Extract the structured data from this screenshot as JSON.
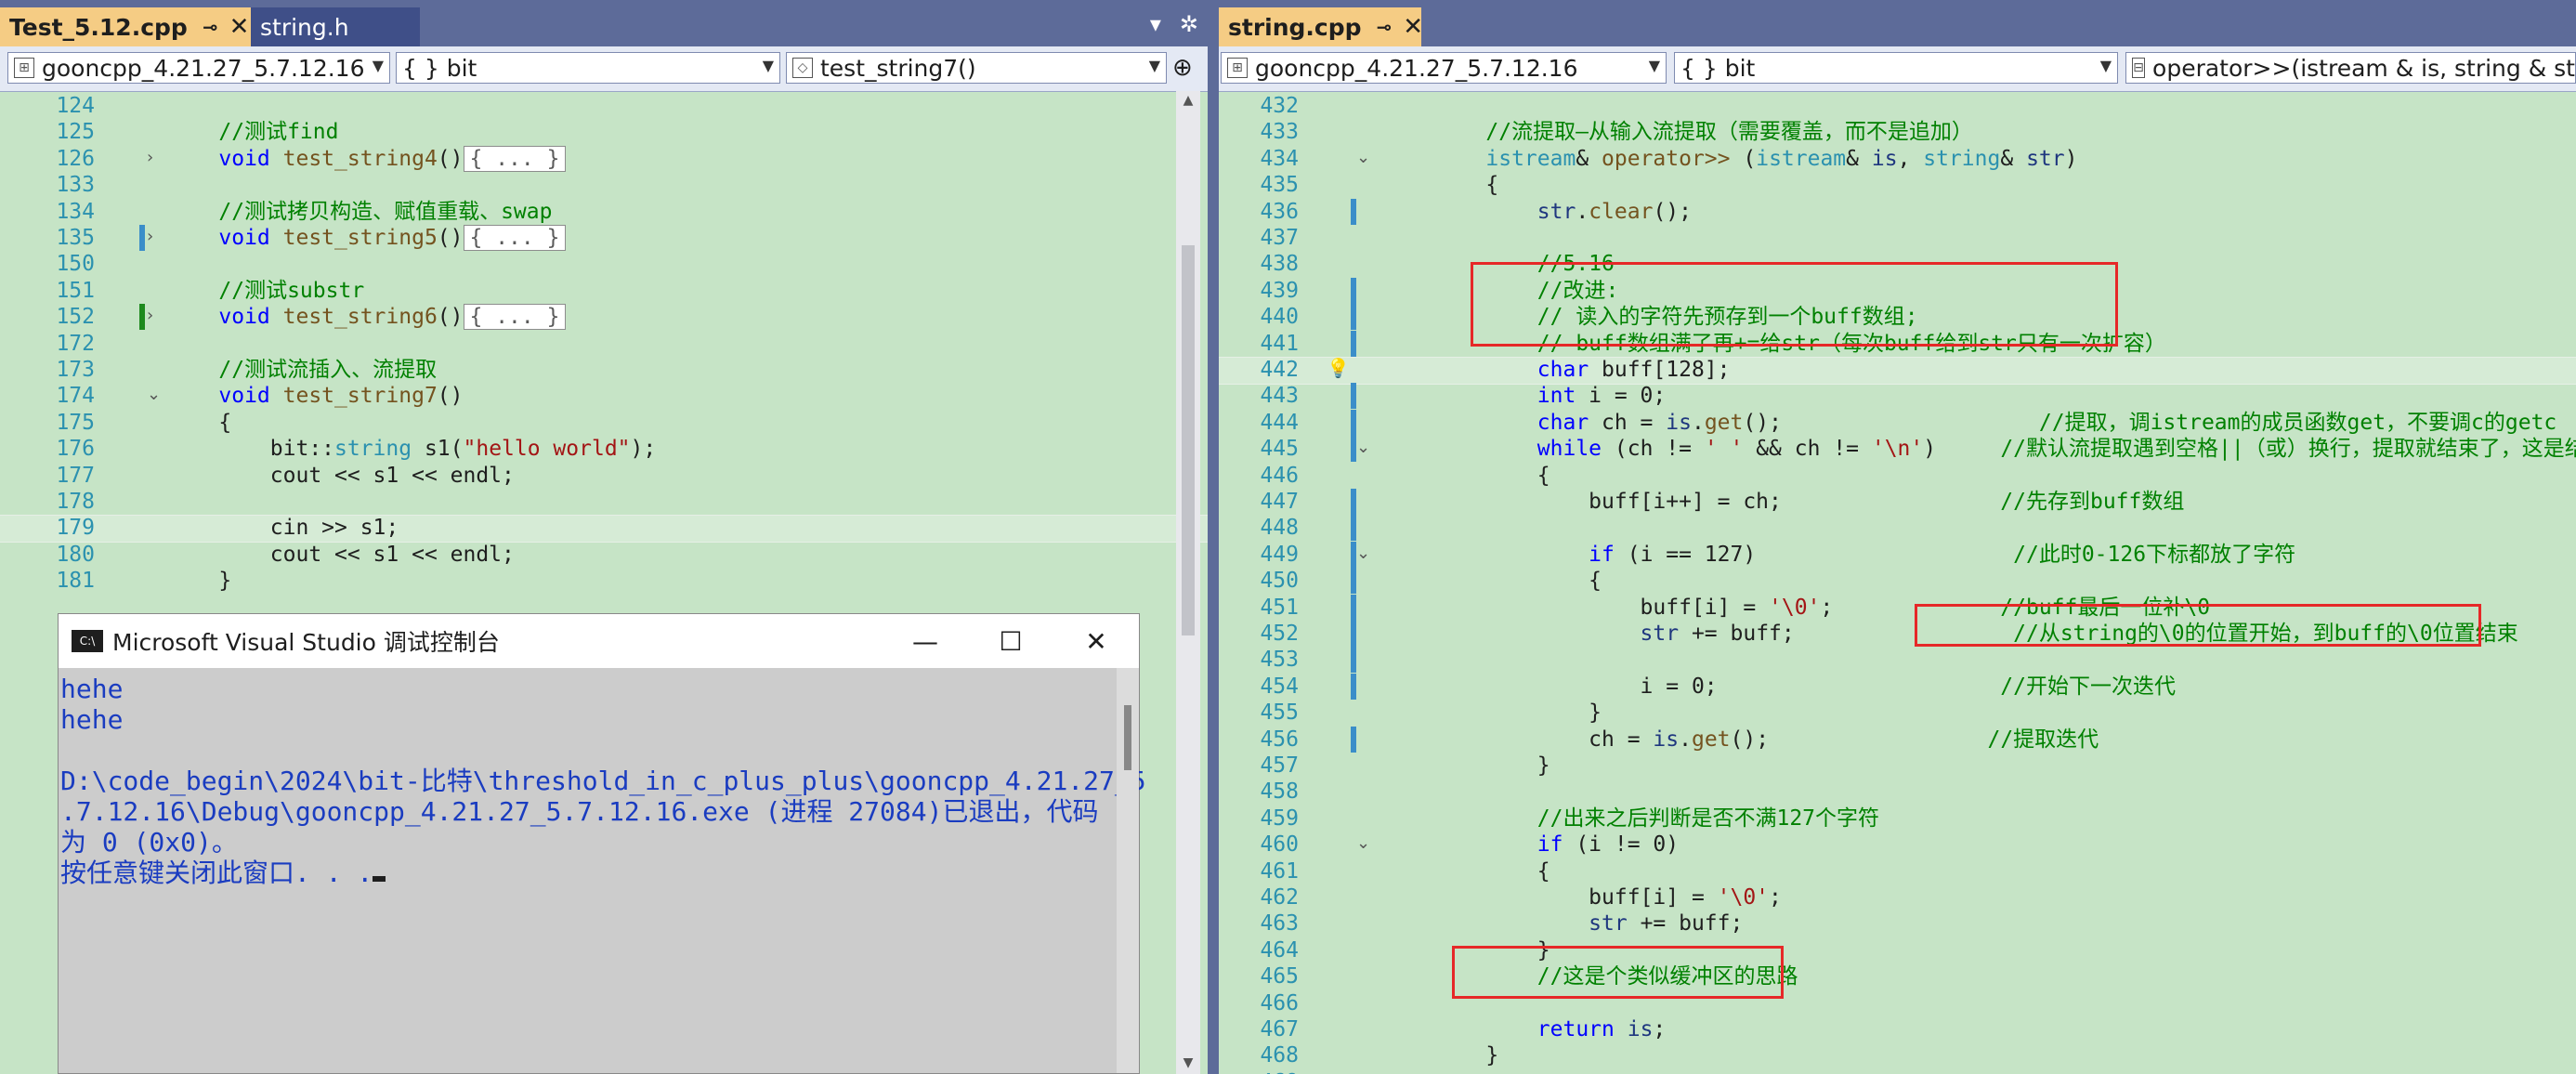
{
  "left_pane": {
    "tabs": [
      {
        "label": "Test_5.12.cpp",
        "pin": "⊸",
        "close": "✕"
      },
      {
        "label": "string.h"
      }
    ],
    "nav": {
      "project": "gooncpp_4.21.27_5.7.12.16",
      "scope": "{ } bit",
      "member": "test_string7()"
    },
    "lines": [
      {
        "n": "124",
        "segs": []
      },
      {
        "n": "125",
        "segs": [
          {
            "c": "cm",
            "t": "    //测试find"
          }
        ]
      },
      {
        "n": "126",
        "segs": [
          {
            "c": "kw",
            "t": "    void "
          },
          {
            "c": "fn",
            "t": "test_string4"
          },
          {
            "c": "",
            "t": "()"
          }
        ],
        "collapsed": "{ ... }"
      },
      {
        "n": "133",
        "segs": []
      },
      {
        "n": "134",
        "segs": [
          {
            "c": "cm",
            "t": "    //测试拷贝构造、赋值重载、swap"
          }
        ]
      },
      {
        "n": "135",
        "segs": [
          {
            "c": "kw",
            "t": "    void "
          },
          {
            "c": "fn",
            "t": "test_string5"
          },
          {
            "c": "",
            "t": "()"
          }
        ],
        "collapsed": "{ ... }"
      },
      {
        "n": "150",
        "segs": []
      },
      {
        "n": "151",
        "segs": [
          {
            "c": "cm",
            "t": "    //测试substr"
          }
        ]
      },
      {
        "n": "152",
        "segs": [
          {
            "c": "kw",
            "t": "    void "
          },
          {
            "c": "fn",
            "t": "test_string6"
          },
          {
            "c": "",
            "t": "()"
          }
        ],
        "collapsed": "{ ... }"
      },
      {
        "n": "172",
        "segs": []
      },
      {
        "n": "173",
        "segs": [
          {
            "c": "cm",
            "t": "    //测试流插入、流提取"
          }
        ]
      },
      {
        "n": "174",
        "segs": [
          {
            "c": "kw",
            "t": "    void "
          },
          {
            "c": "fn",
            "t": "test_string7"
          },
          {
            "c": "",
            "t": "()"
          }
        ]
      },
      {
        "n": "175",
        "segs": [
          {
            "c": "",
            "t": "    {"
          }
        ]
      },
      {
        "n": "176",
        "segs": [
          {
            "c": "",
            "t": "        bit::"
          },
          {
            "c": "ty",
            "t": "string"
          },
          {
            "c": "",
            "t": " s1("
          },
          {
            "c": "st",
            "t": "\"hello world\""
          },
          {
            "c": "",
            "t": ");"
          }
        ]
      },
      {
        "n": "177",
        "segs": [
          {
            "c": "",
            "t": "        cout << s1 << endl;"
          }
        ]
      },
      {
        "n": "178",
        "segs": []
      },
      {
        "n": "179",
        "segs": [
          {
            "c": "",
            "t": "        cin >> s1;"
          }
        ]
      },
      {
        "n": "180",
        "segs": [
          {
            "c": "",
            "t": "        cout << s1 << endl;"
          }
        ]
      },
      {
        "n": "181",
        "segs": [
          {
            "c": "",
            "t": "    }"
          }
        ]
      }
    ]
  },
  "console": {
    "title": "Microsoft Visual Studio 调试控制台",
    "lines": [
      "hehe",
      "hehe",
      "",
      "D:\\code_begin\\2024\\bit-比特\\threshold_in_c_plus_plus\\gooncpp_4.21.27_5",
      ".7.12.16\\Debug\\gooncpp_4.21.27_5.7.12.16.exe (进程 27084)已退出，代码",
      "为 0 (0x0)。",
      "按任意键关闭此窗口. . ."
    ]
  },
  "right_pane": {
    "tab": {
      "label": "string.cpp",
      "pin": "⊸",
      "close": "✕"
    },
    "nav": {
      "project": "gooncpp_4.21.27_5.7.12.16",
      "scope": "{ } bit",
      "member": "operator>>(istream & is, string & st"
    },
    "lines": [
      {
        "n": "432",
        "segs": []
      },
      {
        "n": "433",
        "segs": [
          {
            "c": "cm",
            "t": "    //流提取—从输入流提取（需要覆盖，而不是追加）"
          }
        ]
      },
      {
        "n": "434",
        "segs": [
          {
            "c": "ty",
            "t": "    istream"
          },
          {
            "c": "",
            "t": "& "
          },
          {
            "c": "fn",
            "t": "operator>>"
          },
          {
            "c": "",
            "t": " ("
          },
          {
            "c": "ty",
            "t": "istream"
          },
          {
            "c": "",
            "t": "& "
          },
          {
            "c": "pm",
            "t": "is"
          },
          {
            "c": "",
            "t": ", "
          },
          {
            "c": "ty",
            "t": "string"
          },
          {
            "c": "",
            "t": "& "
          },
          {
            "c": "pm",
            "t": "str"
          },
          {
            "c": "",
            "t": ")"
          }
        ]
      },
      {
        "n": "435",
        "segs": [
          {
            "c": "",
            "t": "    {"
          }
        ]
      },
      {
        "n": "436",
        "segs": [
          {
            "c": "pm",
            "t": "        str"
          },
          {
            "c": "",
            "t": "."
          },
          {
            "c": "fn",
            "t": "clear"
          },
          {
            "c": "",
            "t": "();"
          }
        ]
      },
      {
        "n": "437",
        "segs": []
      },
      {
        "n": "438",
        "segs": [
          {
            "c": "cm",
            "t": "        //5.16"
          }
        ]
      },
      {
        "n": "439",
        "segs": [
          {
            "c": "cm",
            "t": "        //改进:"
          }
        ]
      },
      {
        "n": "440",
        "segs": [
          {
            "c": "cm",
            "t": "        // 读入的字符先预存到一个buff数组;"
          }
        ]
      },
      {
        "n": "441",
        "segs": [
          {
            "c": "cm",
            "t": "        // buff数组满了再+=给str（每次buff给到str只有一次扩容）"
          }
        ]
      },
      {
        "n": "442",
        "segs": [
          {
            "c": "kw",
            "t": "        char "
          },
          {
            "c": "",
            "t": "buff[128];"
          }
        ]
      },
      {
        "n": "443",
        "segs": [
          {
            "c": "kw",
            "t": "        int "
          },
          {
            "c": "",
            "t": "i = 0;"
          }
        ]
      },
      {
        "n": "444",
        "segs": [
          {
            "c": "kw",
            "t": "        char "
          },
          {
            "c": "",
            "t": "ch = "
          },
          {
            "c": "pm",
            "t": "is"
          },
          {
            "c": "",
            "t": "."
          },
          {
            "c": "fn",
            "t": "get"
          },
          {
            "c": "",
            "t": "();                    "
          },
          {
            "c": "cm",
            "t": "//提取，调istream的成员函数get，不要调c的getc"
          }
        ]
      },
      {
        "n": "445",
        "segs": [
          {
            "c": "kw",
            "t": "        while "
          },
          {
            "c": "",
            "t": "(ch != "
          },
          {
            "c": "st",
            "t": "' '"
          },
          {
            "c": "",
            "t": " && ch != "
          },
          {
            "c": "st",
            "t": "'\\n'"
          },
          {
            "c": "",
            "t": ")     "
          },
          {
            "c": "cm",
            "t": "//默认流提取遇到空格||（或）换行，提取就结束了，这是结束条件"
          }
        ]
      },
      {
        "n": "446",
        "segs": [
          {
            "c": "",
            "t": "        {"
          }
        ]
      },
      {
        "n": "447",
        "segs": [
          {
            "c": "",
            "t": "            buff[i++] = ch;                 "
          },
          {
            "c": "cm",
            "t": "//先存到buff数组"
          }
        ]
      },
      {
        "n": "448",
        "segs": []
      },
      {
        "n": "449",
        "segs": [
          {
            "c": "kw",
            "t": "            if "
          },
          {
            "c": "",
            "t": "(i == 127)                    "
          },
          {
            "c": "cm",
            "t": "//此时0-126下标都放了字符"
          }
        ]
      },
      {
        "n": "450",
        "segs": [
          {
            "c": "",
            "t": "            {"
          }
        ]
      },
      {
        "n": "451",
        "segs": [
          {
            "c": "",
            "t": "                buff[i] = "
          },
          {
            "c": "st",
            "t": "'\\0'"
          },
          {
            "c": "",
            "t": ";             "
          },
          {
            "c": "cm",
            "t": "//buff最后一位补\\0"
          }
        ]
      },
      {
        "n": "452",
        "segs": [
          {
            "c": "pm",
            "t": "                str"
          },
          {
            "c": "",
            "t": " += buff;                 "
          },
          {
            "c": "cm",
            "t": "//从string的\\0的位置开始，到buff的\\0位置结束"
          }
        ]
      },
      {
        "n": "453",
        "segs": []
      },
      {
        "n": "454",
        "segs": [
          {
            "c": "",
            "t": "                i = 0;                      "
          },
          {
            "c": "cm",
            "t": "//开始下一次迭代"
          }
        ]
      },
      {
        "n": "455",
        "segs": [
          {
            "c": "",
            "t": "            }"
          }
        ]
      },
      {
        "n": "456",
        "segs": [
          {
            "c": "",
            "t": "            ch = "
          },
          {
            "c": "pm",
            "t": "is"
          },
          {
            "c": "",
            "t": "."
          },
          {
            "c": "fn",
            "t": "get"
          },
          {
            "c": "",
            "t": "();                 "
          },
          {
            "c": "cm",
            "t": "//提取迭代"
          }
        ]
      },
      {
        "n": "457",
        "segs": [
          {
            "c": "",
            "t": "        }"
          }
        ]
      },
      {
        "n": "458",
        "segs": []
      },
      {
        "n": "459",
        "segs": [
          {
            "c": "cm",
            "t": "        //出来之后判断是否不满127个字符"
          }
        ]
      },
      {
        "n": "460",
        "segs": [
          {
            "c": "kw",
            "t": "        if "
          },
          {
            "c": "",
            "t": "(i != 0)"
          }
        ]
      },
      {
        "n": "461",
        "segs": [
          {
            "c": "",
            "t": "        {"
          }
        ]
      },
      {
        "n": "462",
        "segs": [
          {
            "c": "",
            "t": "            buff[i] = "
          },
          {
            "c": "st",
            "t": "'\\0'"
          },
          {
            "c": "",
            "t": ";"
          }
        ]
      },
      {
        "n": "463",
        "segs": [
          {
            "c": "pm",
            "t": "            str"
          },
          {
            "c": "",
            "t": " += buff;"
          }
        ]
      },
      {
        "n": "464",
        "segs": [
          {
            "c": "",
            "t": "        }"
          }
        ]
      },
      {
        "n": "465",
        "segs": [
          {
            "c": "cm",
            "t": "        //这是个类似缓冲区的思路"
          }
        ]
      },
      {
        "n": "466",
        "segs": []
      },
      {
        "n": "467",
        "segs": [
          {
            "c": "kw",
            "t": "        return "
          },
          {
            "c": "pm",
            "t": "is"
          },
          {
            "c": "",
            "t": ";"
          }
        ]
      },
      {
        "n": "468",
        "segs": [
          {
            "c": "",
            "t": "    }"
          }
        ]
      },
      {
        "n": "469",
        "segs": []
      }
    ]
  },
  "icons": {
    "dropdown": "chevron-down-icon",
    "settings": "gear-icon",
    "split": "split-icon",
    "pin": "pin-icon",
    "close": "close-icon",
    "lightbulb": "lightbulb-icon"
  },
  "colors": {
    "editor_bg": "#c6e4c6",
    "active_tab": "#f5cc84",
    "tabstrip": "#5d6b99",
    "redbox": "#e62828"
  }
}
